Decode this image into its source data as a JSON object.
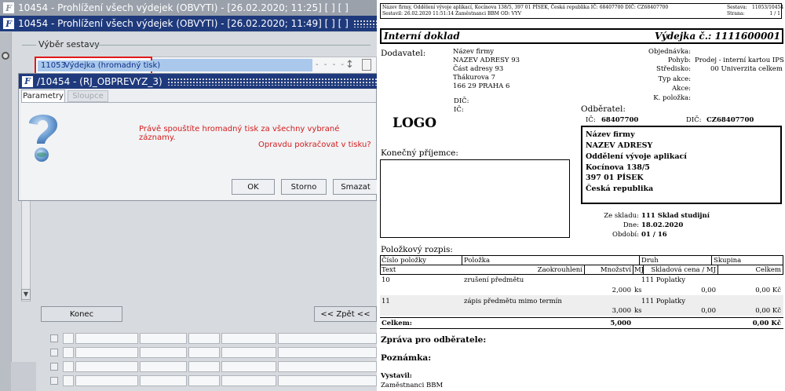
{
  "window": {
    "bg_title": "10454 - Prohlížení všech výdejek (OBVYTI) - [26.02.2020; 11:25]  [ ]  [ ]",
    "fg_title": "10454 - Prohlížení všech výdejek (OBVYTI) - [26.02.2020; 11:49]  [ ]  [ ]",
    "app_icon": "F"
  },
  "panel": {
    "group_label": "Výběr sestavy",
    "selected_item": {
      "number": "11053",
      "label": "Výdejka (hromadný tisk)"
    },
    "dashes": "- - - -"
  },
  "dialog": {
    "title": "/10454 - (RJ_OBPREVYZ_3)",
    "tabs": [
      "Parametry",
      "Sloupce"
    ],
    "message1": "Právě spouštíte hromadný tisk za všechny vybrané záznamy.",
    "message2": "Opravdu pokračovat v tisku?",
    "buttons": {
      "ok": "OK",
      "storno": "Storno",
      "smazat": "Smazat"
    },
    "icon": "question-mark-icon"
  },
  "footer_buttons": {
    "konec": "Konec",
    "zpet": "<< Zpět <<"
  },
  "document": {
    "header_left": "Název firmy, Oddělení vývoje aplikací, Kocínova 138/5, 397 01 PÍSEK, Česká republika  IČ: 68407700  DIČ: CZ68407700",
    "header_left2": "Sestavil: 26.02.2020 11:51:14 Zaměstnanci BBM  OD: VYV",
    "header_right_labels": [
      "Sestava:",
      "Strana:"
    ],
    "header_right_values": [
      "11053/10454",
      "1 / 1"
    ],
    "title_left": "Interní doklad",
    "title_right": "Výdejka č.: 1111600001",
    "supplier_label": "Dodavatel:",
    "supplier": [
      "Název firmy",
      "NAZEV ADRESY 93",
      "Část adresy 93",
      "Thákurova 7",
      "166 29 PRAHA 6"
    ],
    "supplier_ic_label": "DIČ:",
    "supplier_ic_label2": "IČ:",
    "logo": "LOGO",
    "final_recipient_label": "Konečný příjemce:",
    "right_labels": [
      "Objednávka:",
      "Pohyb:",
      "Středisko:",
      "Typ akce:",
      "Akce:",
      "K. položka:"
    ],
    "right_values": [
      "",
      "Prodej - interní kartou IPS",
      "00 Univerzita celkem",
      "",
      "",
      ""
    ],
    "customer_label": "Odběratel:",
    "customer_ic_label": "IČ:",
    "customer_ic": "68407700",
    "customer_dic_label": "DIČ:",
    "customer_dic": "CZ68407700",
    "customer_box": [
      "Název firmy",
      "NAZEV ADRESY",
      "Oddělení vývoje aplikací",
      "Kocínova 138/5",
      "397 01 PÍSEK",
      "Česká republika"
    ],
    "stock_labels": [
      "Ze skladu:",
      "Dne:",
      "Období:"
    ],
    "stock_values": [
      "111 Sklad studijní",
      "18.02.2020",
      "01 / 16"
    ],
    "items_label": "Položkový rozpis:",
    "table_head1": [
      "Číslo položky",
      "Položka",
      "Druh",
      "Skupina"
    ],
    "table_head2": [
      "Text",
      "Zaokrouhlení",
      "Množství",
      "MJ",
      "Skladová cena / MJ",
      "Celkem"
    ],
    "rows": [
      {
        "no": "10",
        "name": "zrušení předmětu",
        "druh": "111 Poplatky",
        "qty": "2,000",
        "mj": "ks",
        "price": "0,00",
        "total": "0,00 Kč"
      },
      {
        "no": "11",
        "name": "zápis předmětu mimo termín",
        "druh": "111 Poplatky",
        "qty": "3,000",
        "mj": "ks",
        "price": "0,00",
        "total": "0,00 Kč"
      }
    ],
    "total_label": "Celkem:",
    "total_qty": "5,000",
    "total_sum": "0,00 Kč",
    "message_label": "Zpráva pro odběratele:",
    "note_label": "Poznámka:",
    "author_label": "Vystavil:",
    "author": "Zaměstnanci BBM"
  }
}
